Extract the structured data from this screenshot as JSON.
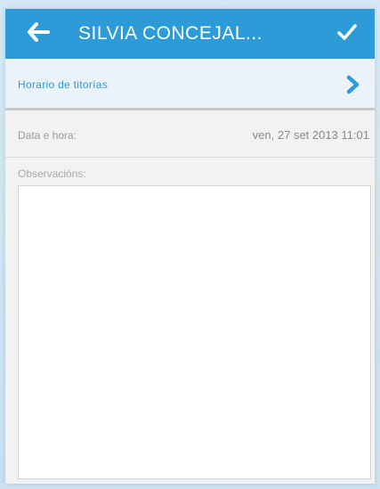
{
  "header": {
    "title": "SILVIA CONCEJAL...",
    "back_icon": "arrow-left-icon",
    "confirm_icon": "checkmark-icon",
    "color": "#2c9bd8"
  },
  "nav": {
    "label": "Horario de titorías",
    "icon": "chevron-right-icon"
  },
  "datetime": {
    "label": "Data e hora:",
    "value": "ven, 27 set 2013 11:01"
  },
  "observations": {
    "label": "Observacións:",
    "value": ""
  }
}
